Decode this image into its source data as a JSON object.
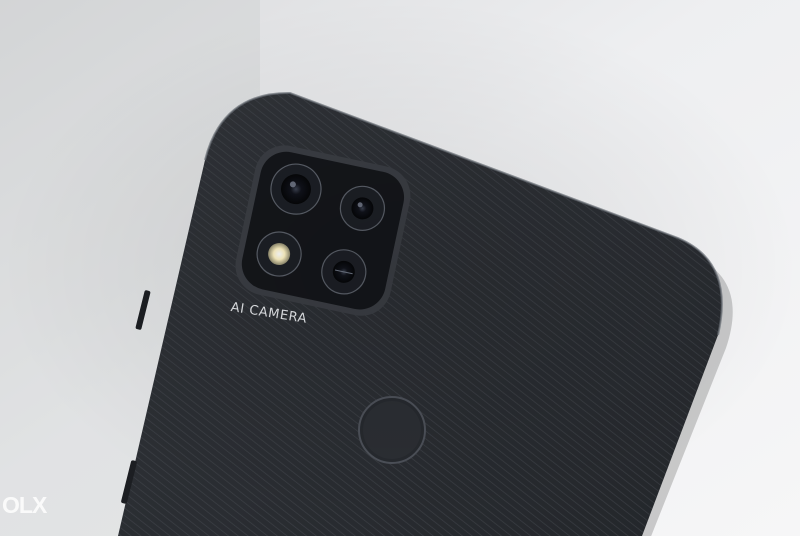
{
  "photo": {
    "subject": "smartphone-back",
    "colors": {
      "background": "#e9eaec",
      "phone_body": "#2b2e33",
      "camera_module": "#14161a",
      "flash": "#fff7d8"
    }
  },
  "camera": {
    "label": "AI CAMERA"
  },
  "watermark": {
    "text": "OLX"
  }
}
